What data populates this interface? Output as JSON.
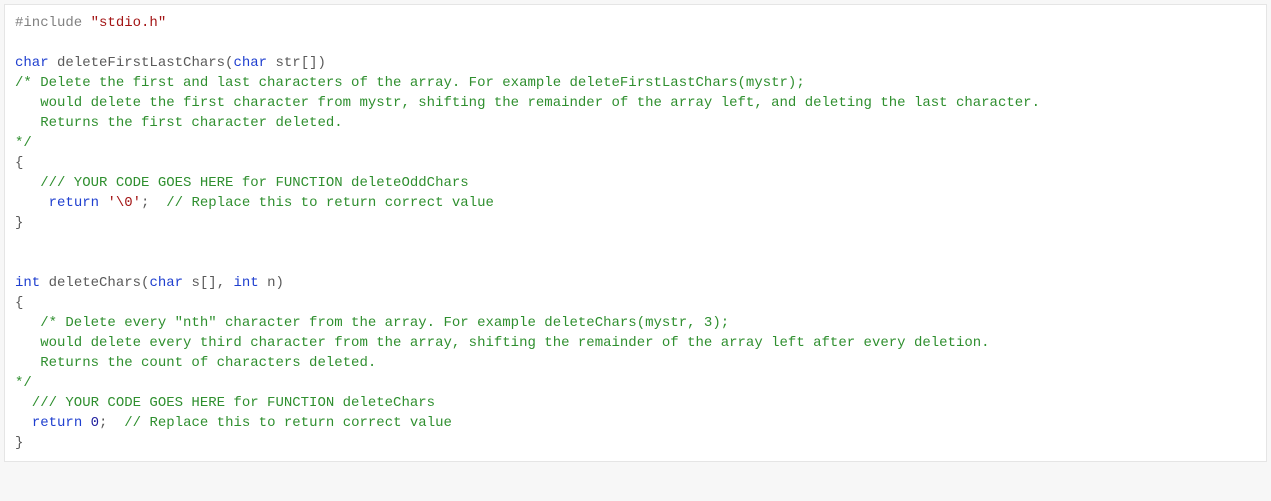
{
  "code": {
    "include_directive": "#include",
    "include_header": "\"stdio.h\"",
    "kw_char": "char",
    "kw_int": "int",
    "kw_return": "return",
    "fn1_name": "deleteFirstLastChars",
    "fn1_params_open": "(",
    "fn1_param_type": "char",
    "fn1_param_name": "str",
    "fn1_params_brackets": "[]",
    "fn1_params_close": ")",
    "fn1_cmt_open": "/* Delete the first and last characters of the array. For example deleteFirstLastChars(mystr);",
    "fn1_cmt_line2": "   would delete the first character from mystr, shifting the remainder of the array left, and deleting the last character.",
    "fn1_cmt_line3": "   Returns the first character deleted.",
    "fn1_cmt_close": "*/",
    "brace_open": "{",
    "brace_close": "}",
    "fn1_todo": "   /// YOUR CODE GOES HERE for FUNCTION deleteOddChars",
    "fn1_return_indent": "    ",
    "fn1_return_val": "'\\0'",
    "semicolon": ";",
    "fn1_return_cmt": "  // Replace this to return correct value",
    "fn2_name": "deleteChars",
    "fn2_params_open": "(",
    "fn2_p1_type": "char",
    "fn2_p1_name": "s",
    "fn2_p1_brackets": "[]",
    "comma_space": ", ",
    "fn2_p2_type": "int",
    "fn2_p2_name": "n",
    "fn2_params_close": ")",
    "fn2_cmt_open": "   /* Delete every \"nth\" character from the array. For example deleteChars(mystr, 3);",
    "fn2_cmt_line2": "   would delete every third character from the array, shifting the remainder of the array left after every deletion.",
    "fn2_cmt_line3": "   Returns the count of characters deleted.",
    "fn2_cmt_close": "*/",
    "fn2_todo": "  /// YOUR CODE GOES HERE for FUNCTION deleteChars",
    "fn2_return_indent": "  ",
    "fn2_return_val": "0",
    "fn2_return_cmt": "  // Replace this to return correct value"
  }
}
